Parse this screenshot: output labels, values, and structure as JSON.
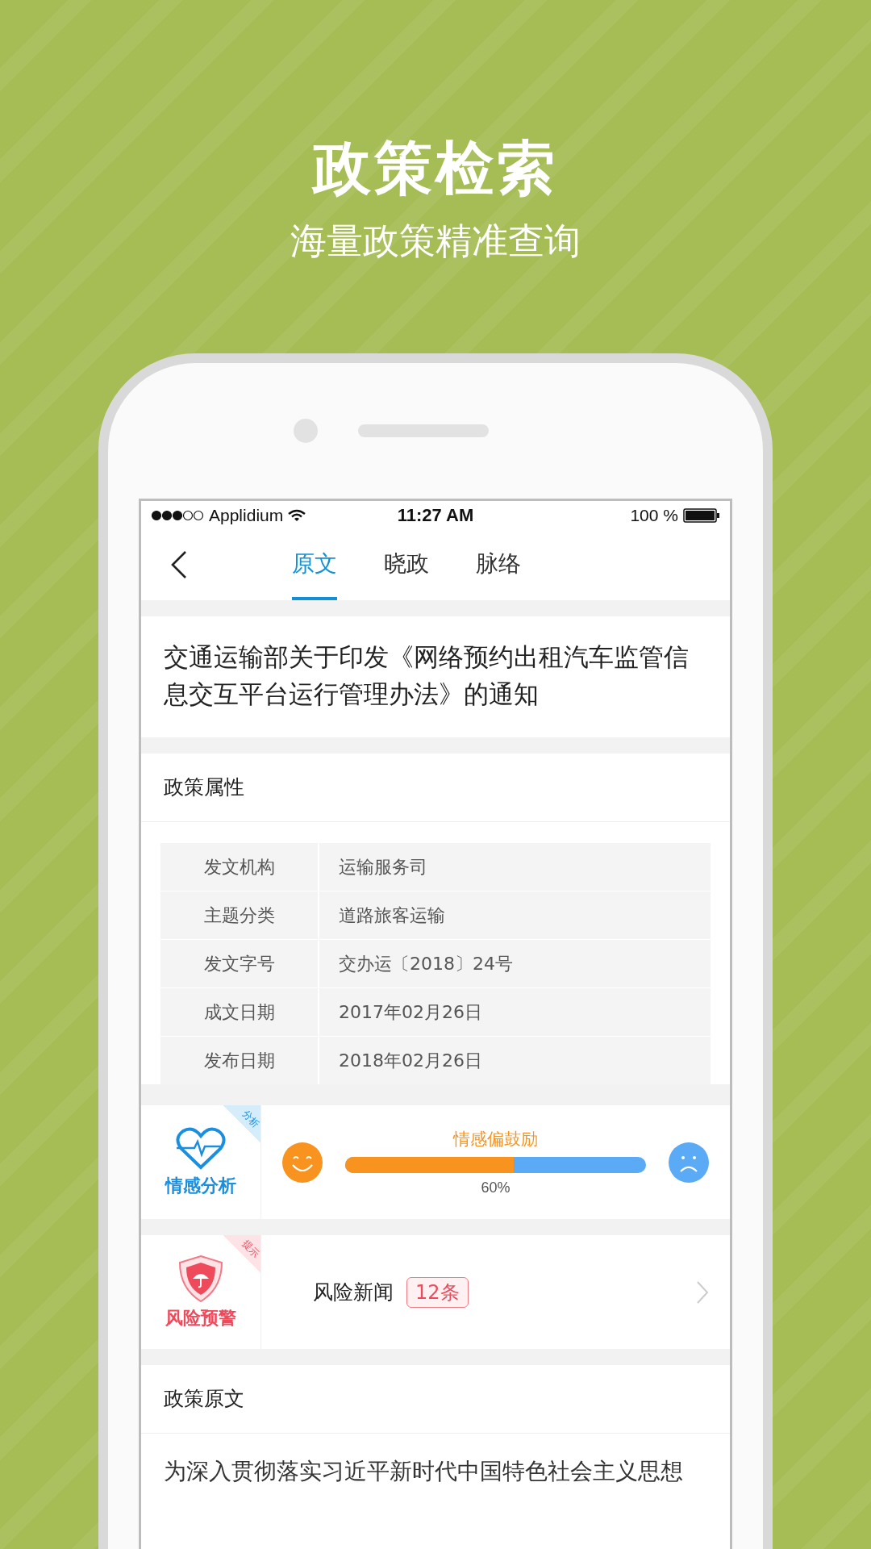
{
  "header": {
    "title": "政策检索",
    "subtitle": "海量政策精准查询"
  },
  "status_bar": {
    "carrier": "Applidium",
    "time": "11:27 AM",
    "battery": "100 %"
  },
  "tabs": [
    {
      "label": "原文",
      "selected": true
    },
    {
      "label": "晓政",
      "selected": false
    },
    {
      "label": "脉络",
      "selected": false
    }
  ],
  "policy_title": "交通运输部关于印发《网络预约出租汽车监管信息交互平台运行管理办法》的通知",
  "attributes": {
    "title": "政策属性",
    "rows": [
      {
        "label": "发文机构",
        "value": "运输服务司"
      },
      {
        "label": "主题分类",
        "value": "道路旅客运输"
      },
      {
        "label": "发文字号",
        "value": "交办运〔2018〕24号"
      },
      {
        "label": "成文日期",
        "value": "2017年02月26日"
      },
      {
        "label": "发布日期",
        "value": "2018年02月26日"
      }
    ]
  },
  "sentiment": {
    "badge": "分析",
    "label": "情感分析",
    "caption": "情感偏鼓励",
    "level": 0.56,
    "reading": "60%"
  },
  "risk": {
    "badge": "提示",
    "label": "风险预警",
    "title": "风险新闻",
    "count": "12条"
  },
  "original_text": {
    "title": "政策原文",
    "body": "为深入贯彻落实习近平新时代中国特色社会主义思想"
  }
}
